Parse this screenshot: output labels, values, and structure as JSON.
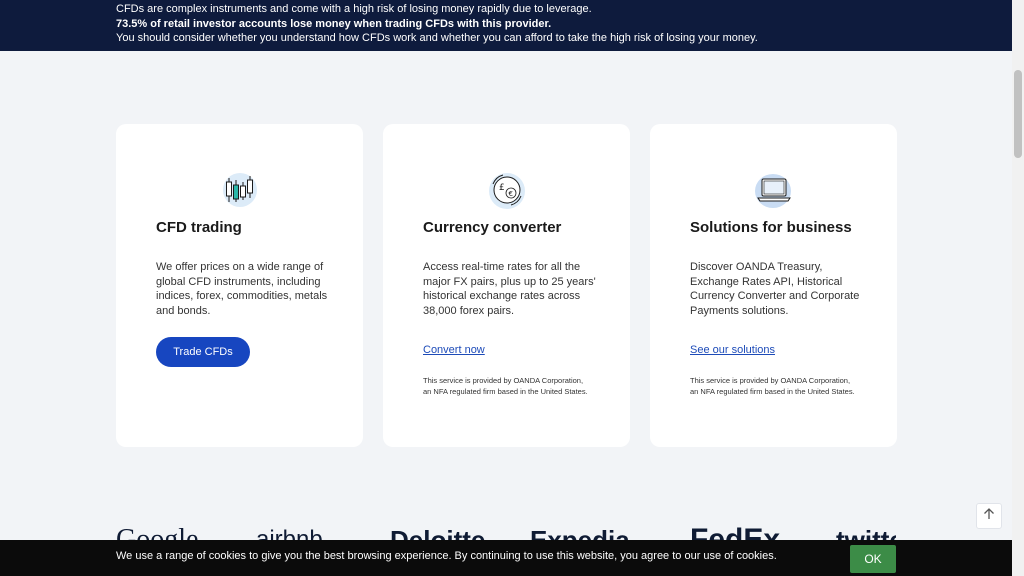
{
  "risk_banner": {
    "line1": "CFDs are complex instruments and come with a high risk of losing money rapidly due to leverage.",
    "line2": "73.5% of retail investor accounts lose money when trading CFDs with this provider.",
    "line3": "You should consider whether you understand how CFDs work and whether you can afford to take the high risk of losing your money."
  },
  "cards": [
    {
      "icon": "candlestick-chart-icon",
      "title": "CFD trading",
      "description": "We offer prices on a wide range of global CFD instruments, including indices, forex, commodities, metals and bonds.",
      "button_label": "Trade CFDs"
    },
    {
      "icon": "currency-exchange-icon",
      "title": "Currency converter",
      "description": "Access real-time rates for all the major FX pairs, plus up to 25 years' historical exchange rates across 38,000 forex pairs.",
      "link_label": "Convert now",
      "note": "This service is provided by OANDA Corporation, an NFA regulated firm based in the United States."
    },
    {
      "icon": "laptop-icon",
      "title": "Solutions for business",
      "description": "Discover OANDA Treasury, Exchange Rates API, Historical Currency Converter and Corporate Payments solutions.",
      "link_label": "See our solutions",
      "note": "This service is provided by OANDA Corporation, an NFA regulated firm based in the United States."
    }
  ],
  "logos": [
    "Google",
    "airbnb",
    "Deloitte",
    "Expedia",
    "FedEx",
    "twitter"
  ],
  "cookie_bar": {
    "text": "We use a range of cookies to give you the best browsing experience. By continuing to use this website, you agree to our use of cookies.",
    "ok_label": "OK"
  },
  "colors": {
    "banner_bg": "#0e1b3d",
    "primary": "#1746c0",
    "ok_green": "#3c8c47",
    "page_bg": "#f2f4f7"
  }
}
